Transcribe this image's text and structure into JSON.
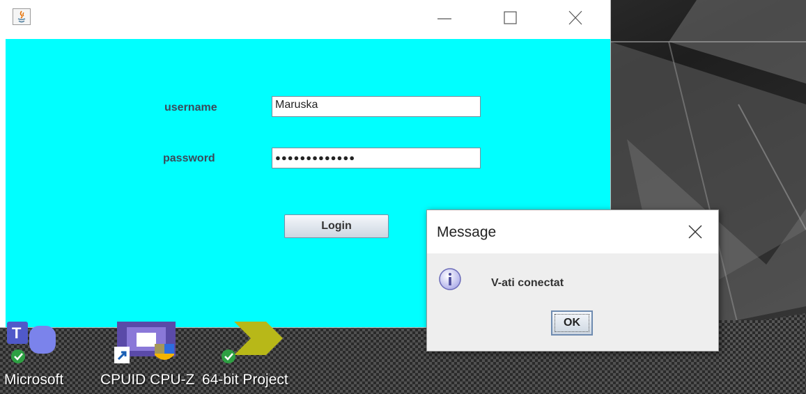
{
  "login_window": {
    "username_label": "username",
    "username_value": "Maruska",
    "password_label": "password",
    "password_masked": "●●●●●●●●●●●●●",
    "login_button": "Login",
    "controls": [
      "minimize-icon",
      "maximize-icon",
      "close-icon"
    ],
    "icon": "java-icon",
    "content_color": "#00ffff"
  },
  "dialog": {
    "title": "Message",
    "message": "V-ati conectat",
    "ok_button": "OK",
    "icon": "info-icon",
    "close": "close-icon"
  },
  "desktop": {
    "labels": [
      "Microsoft",
      "CPUID CPU-Z",
      "64-bit Project"
    ],
    "icons": [
      "microsoft-teams-icon",
      "cpuid-cpuz-icon",
      "project-icon"
    ]
  }
}
